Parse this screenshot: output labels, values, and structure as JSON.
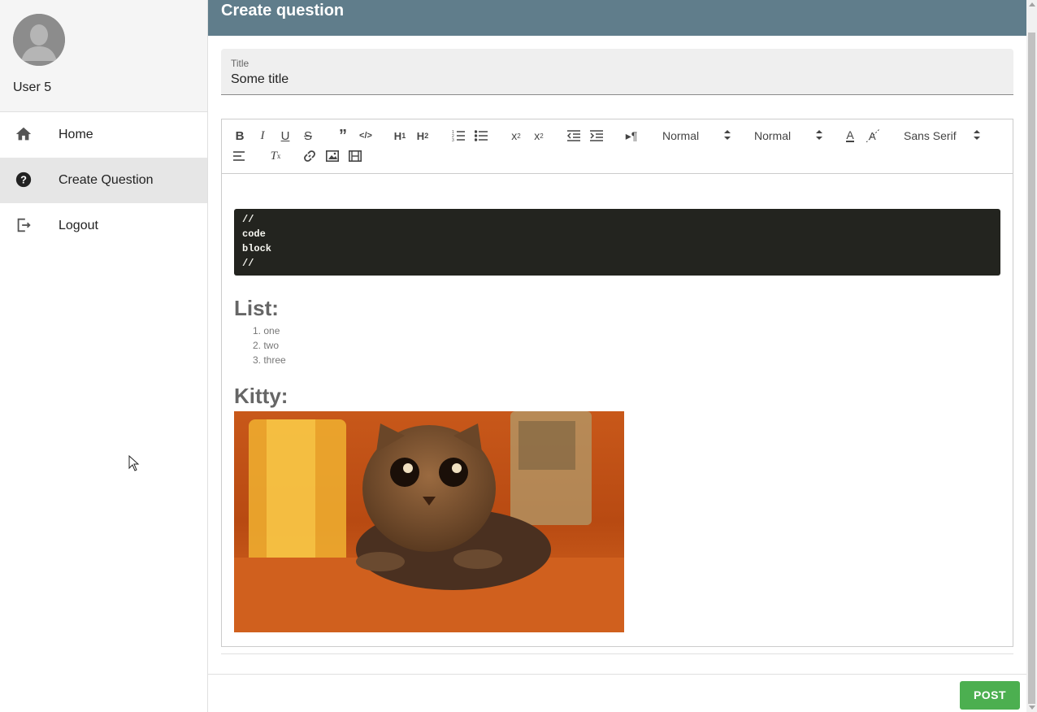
{
  "sidebar": {
    "user_name": "User 5",
    "items": [
      {
        "label": "Home",
        "icon": "home-icon"
      },
      {
        "label": "Create Question",
        "icon": "help-circle-icon",
        "active": true
      },
      {
        "label": "Logout",
        "icon": "logout-icon"
      }
    ]
  },
  "header": {
    "title": "Create question"
  },
  "form": {
    "title_label": "Title",
    "title_value": "Some title"
  },
  "toolbar": {
    "header_select": "Normal",
    "size_select": "Normal",
    "font_select": "Sans Serif",
    "buttons": [
      "bold",
      "italic",
      "underline",
      "strike",
      "blockquote",
      "code",
      "h1",
      "h2",
      "ordered-list",
      "bullet-list",
      "subscript",
      "superscript",
      "outdent",
      "indent",
      "rtl",
      "color",
      "background",
      "align",
      "clean",
      "link",
      "image",
      "video"
    ]
  },
  "editor": {
    "code_lines": [
      "//",
      "code",
      "block",
      "//"
    ],
    "list_heading": "List:",
    "list_items": [
      "1. one",
      "2. two",
      "3. three"
    ],
    "kitty_heading": "Kitty:"
  },
  "actions": {
    "post_label": "POST"
  },
  "colors": {
    "appbar": "#607d8b",
    "post_button": "#4caf50",
    "code_bg": "#23241f"
  }
}
